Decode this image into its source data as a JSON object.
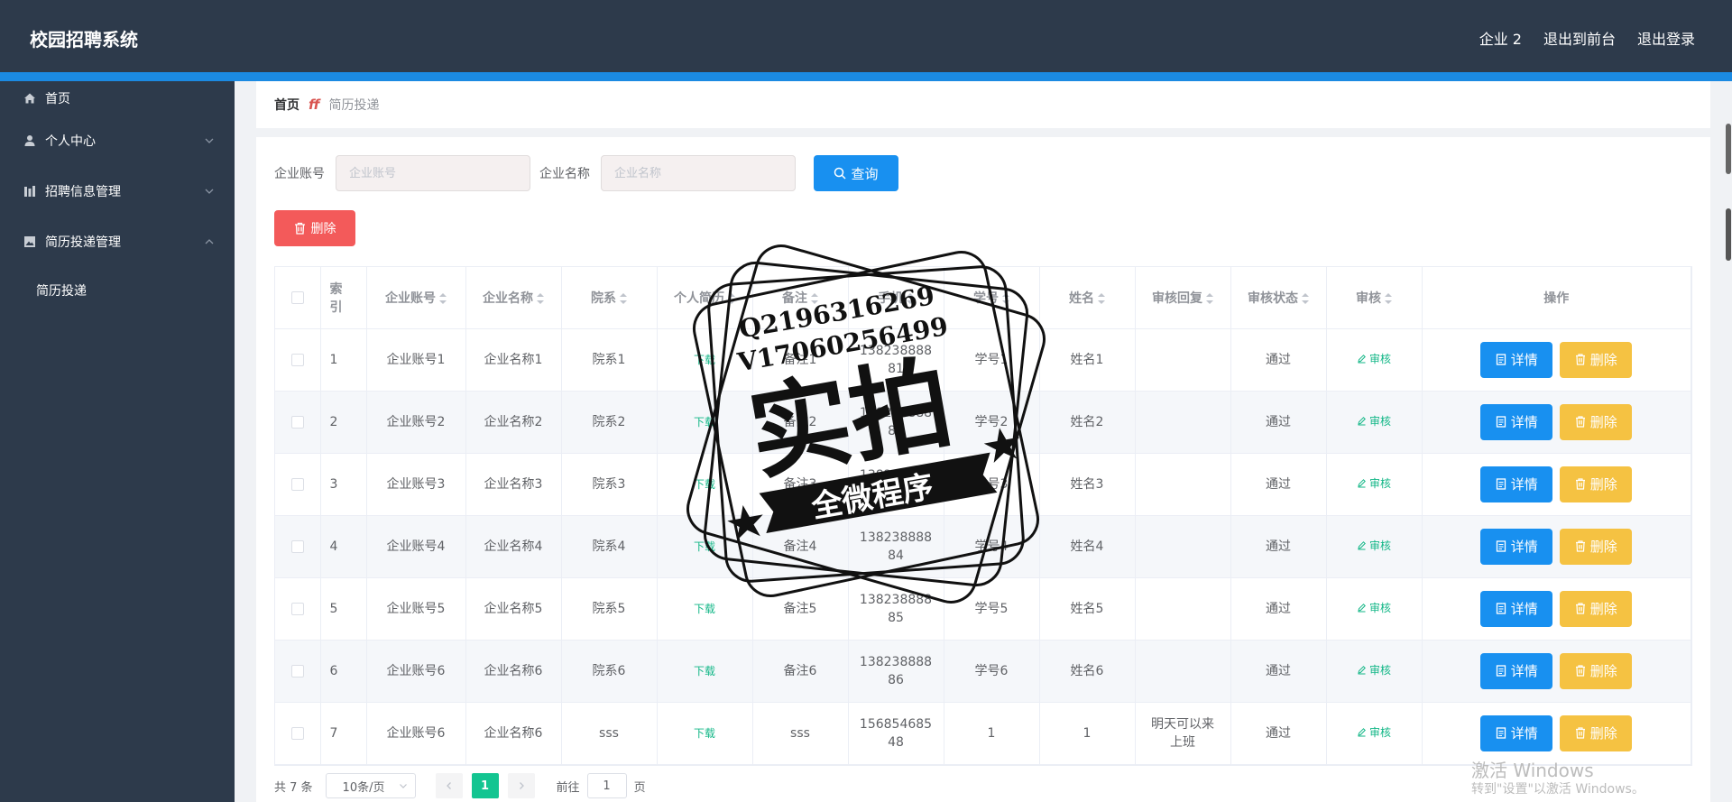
{
  "header": {
    "app_title": "校园招聘系统",
    "user": "企业 2",
    "to_front": "退出到前台",
    "logout": "退出登录"
  },
  "sidebar": {
    "items": [
      {
        "label": "首页",
        "icon": "home-icon"
      },
      {
        "label": "个人中心",
        "icon": "user-icon"
      },
      {
        "label": "招聘信息管理",
        "icon": "chart-icon"
      },
      {
        "label": "简历投递管理",
        "icon": "image-icon"
      }
    ],
    "sub_item": "简历投递"
  },
  "breadcrumb": {
    "home": "首页",
    "separator": "ff",
    "current": "简历投递"
  },
  "search": {
    "account_label": "企业账号",
    "account_placeholder": "企业账号",
    "name_label": "企业名称",
    "name_placeholder": "企业名称",
    "query_label": "查询"
  },
  "bulk_delete_label": "删除",
  "table": {
    "columns": {
      "index_a": "索",
      "index_b": "引",
      "account": "企业账号",
      "name": "企业名称",
      "dept": "院系",
      "resume": "个人简历",
      "remark": "备注",
      "phone": "手机",
      "student_no": "学号",
      "student_name": "姓名",
      "reply": "审核回复",
      "status": "审核状态",
      "audit": "审核",
      "ops": "操作"
    },
    "download_label": "下载",
    "audit_label": "审核",
    "detail_label": "详情",
    "delete_label": "删除",
    "rows": [
      {
        "idx": "1",
        "account": "企业账号1",
        "name": "企业名称1",
        "dept": "院系1",
        "remark": "备注1",
        "phone_a": "138238888",
        "phone_b": "81",
        "sno": "学号1",
        "sname": "姓名1",
        "reply": "",
        "status": "通过"
      },
      {
        "idx": "2",
        "account": "企业账号2",
        "name": "企业名称2",
        "dept": "院系2",
        "remark": "备注2",
        "phone_a": "138238888",
        "phone_b": "82",
        "sno": "学号2",
        "sname": "姓名2",
        "reply": "",
        "status": "通过"
      },
      {
        "idx": "3",
        "account": "企业账号3",
        "name": "企业名称3",
        "dept": "院系3",
        "remark": "备注3",
        "phone_a": "138238888",
        "phone_b": "83",
        "sno": "学号3",
        "sname": "姓名3",
        "reply": "",
        "status": "通过"
      },
      {
        "idx": "4",
        "account": "企业账号4",
        "name": "企业名称4",
        "dept": "院系4",
        "remark": "备注4",
        "phone_a": "138238888",
        "phone_b": "84",
        "sno": "学号4",
        "sname": "姓名4",
        "reply": "",
        "status": "通过"
      },
      {
        "idx": "5",
        "account": "企业账号5",
        "name": "企业名称5",
        "dept": "院系5",
        "remark": "备注5",
        "phone_a": "138238888",
        "phone_b": "85",
        "sno": "学号5",
        "sname": "姓名5",
        "reply": "",
        "status": "通过"
      },
      {
        "idx": "6",
        "account": "企业账号6",
        "name": "企业名称6",
        "dept": "院系6",
        "remark": "备注6",
        "phone_a": "138238888",
        "phone_b": "86",
        "sno": "学号6",
        "sname": "姓名6",
        "reply": "",
        "status": "通过"
      },
      {
        "idx": "7",
        "account": "企业账号6",
        "name": "企业名称6",
        "dept": "sss",
        "remark": "sss",
        "phone_a": "156854685",
        "phone_b": "48",
        "sno": "1",
        "sname": "1",
        "reply_a": "明天可以来",
        "reply_b": "上班",
        "status": "通过"
      }
    ]
  },
  "pager": {
    "total": "共 7 条",
    "page_size": "10条/页",
    "current_page": "1",
    "goto_label": "前往",
    "goto_value": "1",
    "page_unit": "页"
  },
  "watermark": {
    "line1": "Q2196316269",
    "line2": "V17060256499",
    "big": "实拍",
    "ribbon": "全微程序"
  },
  "windows": {
    "line1": "激活 Windows",
    "line2": "转到\"设置\"以激活 Windows。"
  }
}
